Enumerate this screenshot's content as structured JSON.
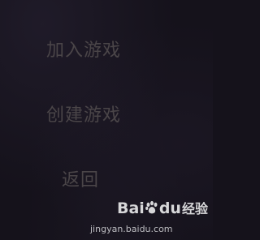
{
  "menu": {
    "join_game": "加入游戏",
    "create_game": "创建游戏",
    "back": "返回"
  },
  "watermark": {
    "brand_prefix": "Bai",
    "brand_suffix": "du",
    "brand_cn": "经验",
    "url": "jingyan.baidu.com"
  },
  "colors": {
    "background": "#15121b",
    "menu_text": "#4a4548"
  }
}
